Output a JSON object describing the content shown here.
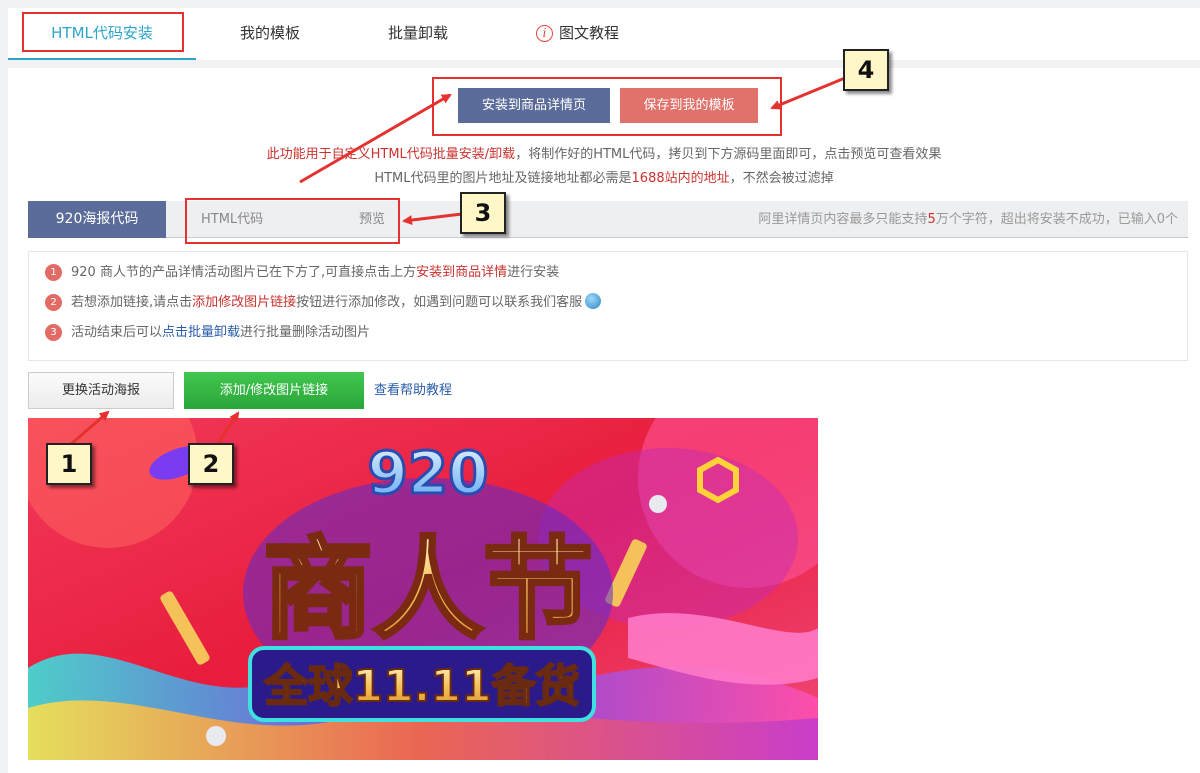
{
  "tabs": {
    "html_install": "HTML代码安装",
    "my_templates": "我的模板",
    "batch_uninstall": "批量卸载",
    "tutorial": "图文教程",
    "tutorial_icon": "i"
  },
  "actions": {
    "install_detail": "安装到商品详情页",
    "save_template": "保存到我的模板"
  },
  "notice": {
    "line1_highlight": "此功能用于自定义HTML代码批量安装/卸载",
    "line1_rest": "，将制作好的HTML代码，拷贝到下方源码里面即可，点击预览可查看效果",
    "line2_start": "HTML代码里的图片地址及链接地址都必需是",
    "line2_highlight": "1688站内的地址",
    "line2_end": "，不然会被过滤掉"
  },
  "subtabs": {
    "poster_code": "920海报代码",
    "html_code": "HTML代码",
    "preview": "预览",
    "limit_start": "阿里详情页内容最多只能支持",
    "limit_number": "5",
    "limit_end": "万个字符，超出将安装不成功，已输入0个"
  },
  "tips": [
    {
      "num": "1",
      "a": "920 商人节的产品详情活动图片已在下方了,可直接点击上方",
      "b": "安装到商品详情",
      "c": "进行安装"
    },
    {
      "num": "2",
      "a": "若想添加链接,请点击",
      "b": "添加修改图片链接",
      "c": "按钮进行添加修改，如遇到问题可以联系我们客服"
    },
    {
      "num": "3",
      "a": "活动结束后可以",
      "b": "点击批量卸载",
      "c": "进行批量删除活动图片"
    }
  ],
  "buttons": {
    "change_poster": "更换活动海报",
    "edit_link": "添加/修改图片链接",
    "help": "查看帮助教程"
  },
  "poster": {
    "number": "920",
    "title": "商人节",
    "subtitle": "全球11.11备货"
  },
  "callouts": [
    "1",
    "2",
    "3",
    "4"
  ],
  "colors": {
    "accent": "#2ba5c9",
    "primary_button": "#5b6c9b",
    "save_button": "#e1726b",
    "green_button": "#36b545",
    "highlight_red": "#c9332e",
    "annotation_red": "#e5312f"
  }
}
